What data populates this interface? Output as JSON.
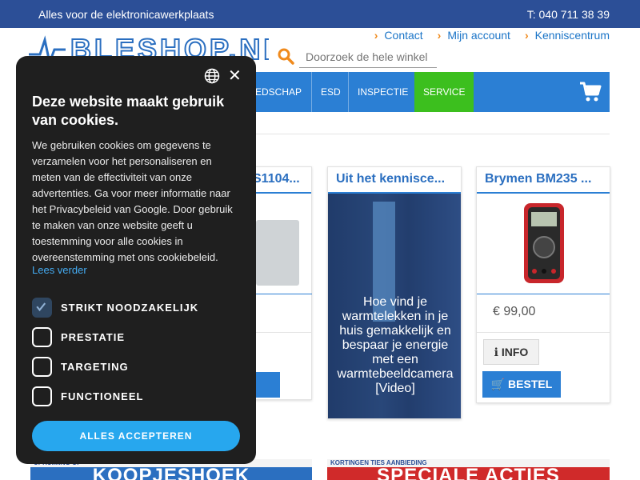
{
  "topbar": {
    "tagline": "Alles voor de elektronicawerkplaats",
    "phone": "T: 040 711 38 39"
  },
  "toplinks": [
    {
      "label": "Contact"
    },
    {
      "label": "Mijn account"
    },
    {
      "label": "Kenniscentrum"
    }
  ],
  "logo": {
    "text": "BLESHOP.NL"
  },
  "search": {
    "placeholder": "Doorzoek de hele winkel"
  },
  "nav": {
    "items": [
      {
        "label": "EEDSCHAP"
      },
      {
        "label": "ESD"
      },
      {
        "label": "INSPECTIE"
      },
      {
        "label": "SERVICE"
      }
    ],
    "service_color": "#3cbf1e",
    "bar_color": "#2b7fd4"
  },
  "products": [
    {
      "title": "S1104..."
    },
    {
      "title": "Uit het kennisce...",
      "caption": "Hoe vind je warmtelekken in je huis gemakkelijk en bespaar je energie met een warmtebeeldcamera [Video]"
    },
    {
      "title": "Brymen BM235 ...",
      "price": "€ 99,00",
      "info_label": "INFO",
      "buy_label": "BESTEL"
    }
  ],
  "banners": [
    {
      "strip": "UPRUIMING OI",
      "text": "KOOPJESHOEK"
    },
    {
      "strip": "KORTINGEN   TIES  AANBIEDING",
      "text": "SPECIALE ACTIES"
    }
  ],
  "cookie": {
    "title": "Deze website maakt gebruik van cookies.",
    "body": "We gebruiken cookies om gegevens te verzamelen voor het personaliseren en meten van de effectiviteit van onze advertenties. Ga voor meer informatie naar het Privacybeleid van Google. Door gebruik te maken van onze website geeft u toestemming voor alle cookies in overeenstemming met ons cookiebeleid.",
    "more": "Lees verder",
    "options": [
      {
        "label": "STRIKT NOODZAKELIJK",
        "checked": true
      },
      {
        "label": "PRESTATIE",
        "checked": false
      },
      {
        "label": "TARGETING",
        "checked": false
      },
      {
        "label": "FUNCTIONEEL",
        "checked": false
      }
    ],
    "accept": "ALLES ACCEPTEREN",
    "accent": "#27a7ee"
  }
}
